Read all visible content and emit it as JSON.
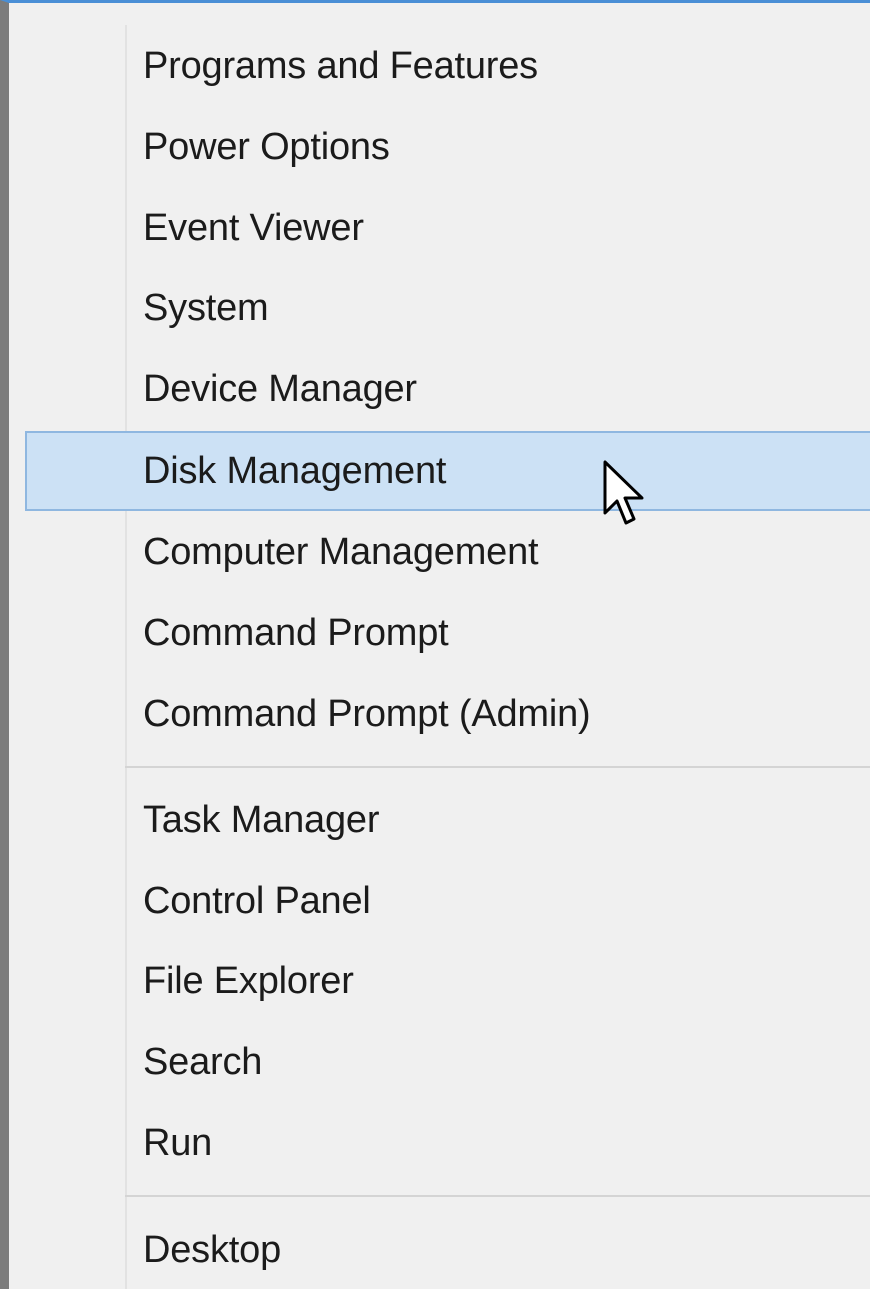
{
  "context_menu": {
    "group1": [
      {
        "label": "Programs and Features"
      },
      {
        "label": "Power Options"
      },
      {
        "label": "Event Viewer"
      },
      {
        "label": "System"
      },
      {
        "label": "Device Manager"
      },
      {
        "label": "Disk Management",
        "highlighted": true
      },
      {
        "label": "Computer Management"
      },
      {
        "label": "Command Prompt"
      },
      {
        "label": "Command Prompt (Admin)"
      }
    ],
    "group2": [
      {
        "label": "Task Manager"
      },
      {
        "label": "Control Panel"
      },
      {
        "label": "File Explorer"
      },
      {
        "label": "Search"
      },
      {
        "label": "Run"
      }
    ],
    "group3": [
      {
        "label": "Desktop"
      }
    ]
  },
  "colors": {
    "menu_background": "#f0f0f0",
    "highlight_fill": "#cce1f5",
    "highlight_border": "#8fb7e0",
    "top_accent": "#4a8fd6",
    "text": "#1b1b1b"
  },
  "cursor_icon": "mouse-pointer-arrow-icon"
}
